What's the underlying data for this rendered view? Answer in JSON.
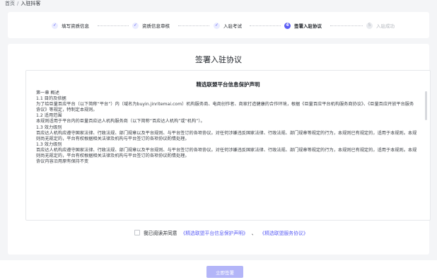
{
  "breadcrumb": {
    "home": "首页",
    "separator": "/",
    "current": "入驻抖客"
  },
  "steps": [
    {
      "label": "填写资质信息",
      "state": "done",
      "marker": "✓"
    },
    {
      "label": "资质信息审核",
      "state": "done",
      "marker": "✓"
    },
    {
      "label": "入驻考试",
      "state": "done",
      "marker": "✓"
    },
    {
      "label": "签署入驻协议",
      "state": "active",
      "marker": "4"
    },
    {
      "label": "入驻成功",
      "state": "todo",
      "marker": "5"
    }
  ],
  "main": {
    "title": "签署入驻协议",
    "document": {
      "title": "精选联盟平台信息保护声明",
      "paragraphs": [
        "第一章 概述",
        "1.1 目的及依据",
        "为了给巨量百应平台（以下简称“平台”）内（域名为buyin.jinritemai.com）机构服务商、电商创作者、商家打造健康的合作环境，根据《巨量百应平台机构服务商协议》、《巨量百应开放平台服务协议》等规定，特制定本规则。",
        "1.2 适用范围",
        "本规则适用于平台内的巨量百应达人机构服务商（以下简称“百应达人机构”或“机构”）。",
        "1.3 效力级别",
        "百应达人机构应遵守国家法律、行政法规、部门规章以及平台规则、与平台签订的各项协议。对任何涉嫌违反国家法律、行政法规、部门规章等规定的行为，本规则已有规定的，适用于本规则。本规则尚无规定的，平台有权根据相关法律及机构与平台签订的各项协议酌情处理。",
        "1.3 效力级别",
        "百应达人机构应遵守国家法律、行政法规、部门规章以及平台规则、与平台签订的各项协议。对任何涉嫌违反国家法律、行政法规、部门规章等规定的行为，本规则已有规定的，适用于本规则。本规则尚无规定的，平台有权根据相关法律及机构与平台签订的各项协议酌情处理。",
        "协议内容沿用原有保持不变"
      ]
    },
    "agreement": {
      "prefix": "我已阅读并同意",
      "link1": "《精选联盟平台信息保护声明》",
      "joiner": "、",
      "link2": "《精选联盟服务协议》",
      "checked": false
    }
  },
  "footer": {
    "submit_label": "立即签署"
  },
  "colors": {
    "accent": "#5b5ef5",
    "accent_disabled": "#b3b5f8",
    "background": "#f4f5f7"
  }
}
